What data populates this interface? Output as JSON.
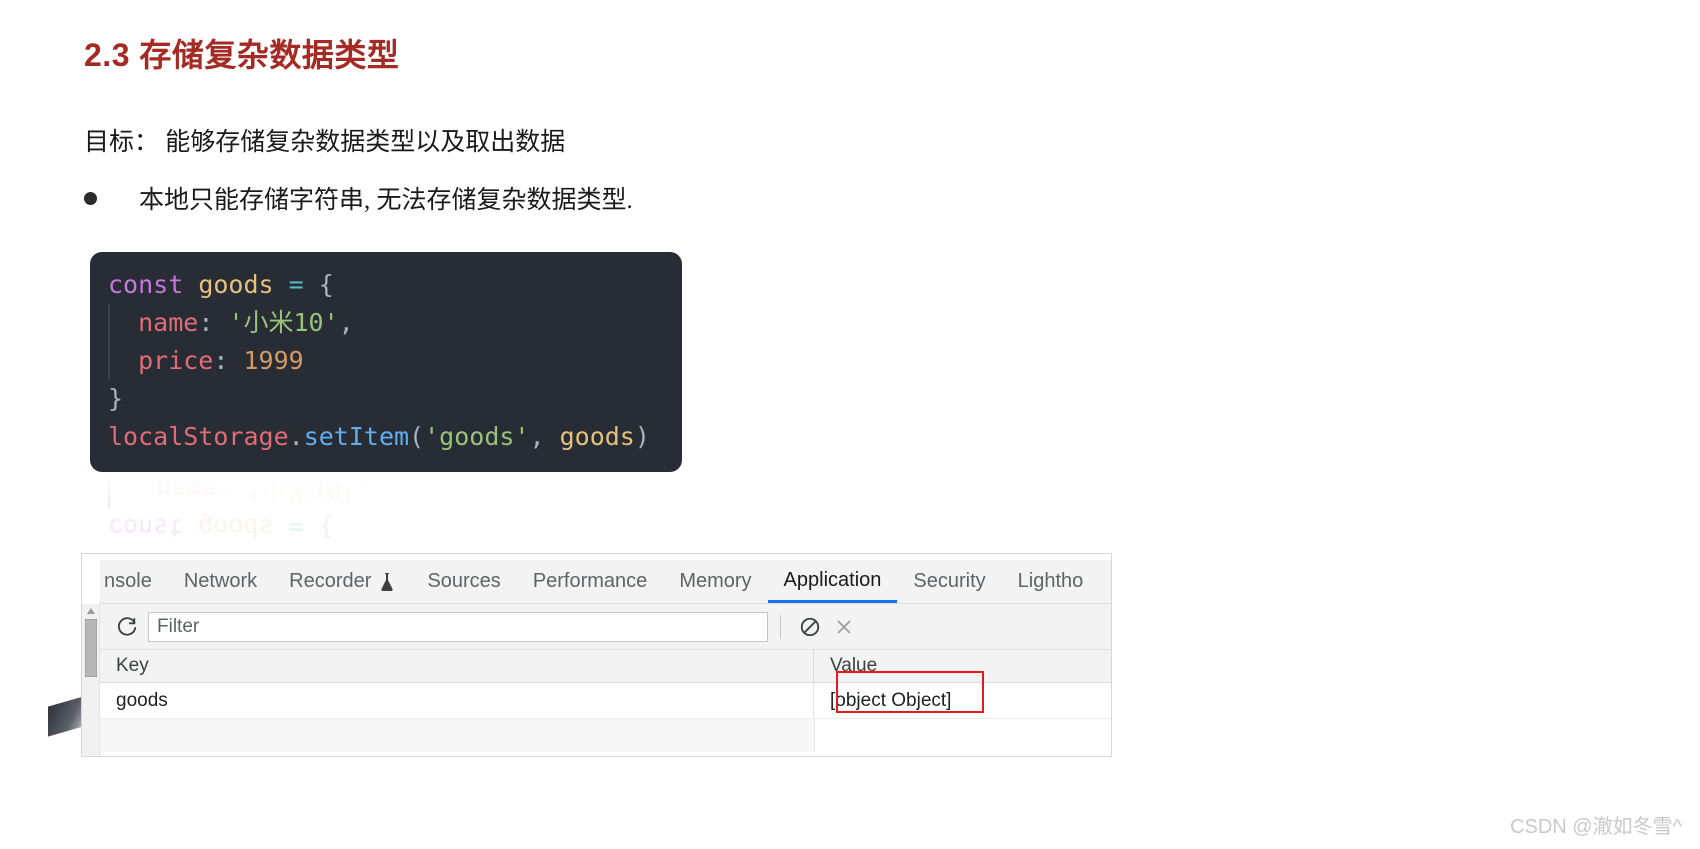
{
  "article": {
    "title": "2.3 存储复杂数据类型",
    "goal_line": "目标： 能够存储复杂数据类型以及取出数据",
    "bullet": "本地只能存储字符串, 无法存储复杂数据类型."
  },
  "code": {
    "language": "javascript",
    "lines": [
      {
        "tokens": [
          {
            "t": "const",
            "c": "kw"
          },
          {
            "t": " ",
            "c": "punct"
          },
          {
            "t": "goods",
            "c": "var"
          },
          {
            "t": " ",
            "c": "punct"
          },
          {
            "t": "=",
            "c": "op"
          },
          {
            "t": " ",
            "c": "punct"
          },
          {
            "t": "{",
            "c": "punct"
          }
        ],
        "indent_guide": false
      },
      {
        "tokens": [
          {
            "t": "  name",
            "c": "prop"
          },
          {
            "t": ":",
            "c": "punct"
          },
          {
            "t": " ",
            "c": "punct"
          },
          {
            "t": "'小米10'",
            "c": "str"
          },
          {
            "t": ",",
            "c": "punct"
          }
        ],
        "indent_guide": true
      },
      {
        "tokens": [
          {
            "t": "  price",
            "c": "prop"
          },
          {
            "t": ":",
            "c": "punct"
          },
          {
            "t": " ",
            "c": "punct"
          },
          {
            "t": "1999",
            "c": "num"
          }
        ],
        "indent_guide": true
      },
      {
        "tokens": [
          {
            "t": "}",
            "c": "punct"
          }
        ],
        "indent_guide": false
      },
      {
        "tokens": [
          {
            "t": "localStorage",
            "c": "obj"
          },
          {
            "t": ".",
            "c": "punct"
          },
          {
            "t": "setItem",
            "c": "fn"
          },
          {
            "t": "(",
            "c": "punct"
          },
          {
            "t": "'goods'",
            "c": "str"
          },
          {
            "t": ",",
            "c": "punct"
          },
          {
            "t": " ",
            "c": "punct"
          },
          {
            "t": "goods",
            "c": "var"
          },
          {
            "t": ")",
            "c": "punct"
          }
        ],
        "indent_guide": false
      }
    ],
    "colors": {
      "background": "#282c34",
      "keyword": "#c678dd",
      "variable": "#e5c07b",
      "operator": "#56b6c2",
      "punctuation": "#abb2bf",
      "property": "#e06c75",
      "string": "#98c379",
      "number": "#d19a66",
      "function": "#61afef"
    }
  },
  "devtools": {
    "tabs": [
      {
        "label": "nsole",
        "active": false,
        "icon": null
      },
      {
        "label": "Network",
        "active": false,
        "icon": null
      },
      {
        "label": "Recorder",
        "active": false,
        "icon": "flask-icon"
      },
      {
        "label": "Sources",
        "active": false,
        "icon": null
      },
      {
        "label": "Performance",
        "active": false,
        "icon": null
      },
      {
        "label": "Memory",
        "active": false,
        "icon": null
      },
      {
        "label": "Application",
        "active": true,
        "icon": null
      },
      {
        "label": "Security",
        "active": false,
        "icon": null
      },
      {
        "label": "Lightho",
        "active": false,
        "icon": null
      }
    ],
    "active_tab_color": "#1a73e8",
    "toolbar": {
      "refresh_icon": "refresh-icon",
      "filter_placeholder": "Filter",
      "filter_value": "",
      "clear_icon": "no-entry-icon",
      "delete_icon": "close-icon"
    },
    "table": {
      "columns": [
        "Key",
        "Value"
      ],
      "rows": [
        {
          "key": "goods",
          "value": "[object Object]",
          "highlighted": true
        }
      ],
      "highlight_color": "#e8191b"
    }
  },
  "watermark": "CSDN @澈如冬雪^"
}
